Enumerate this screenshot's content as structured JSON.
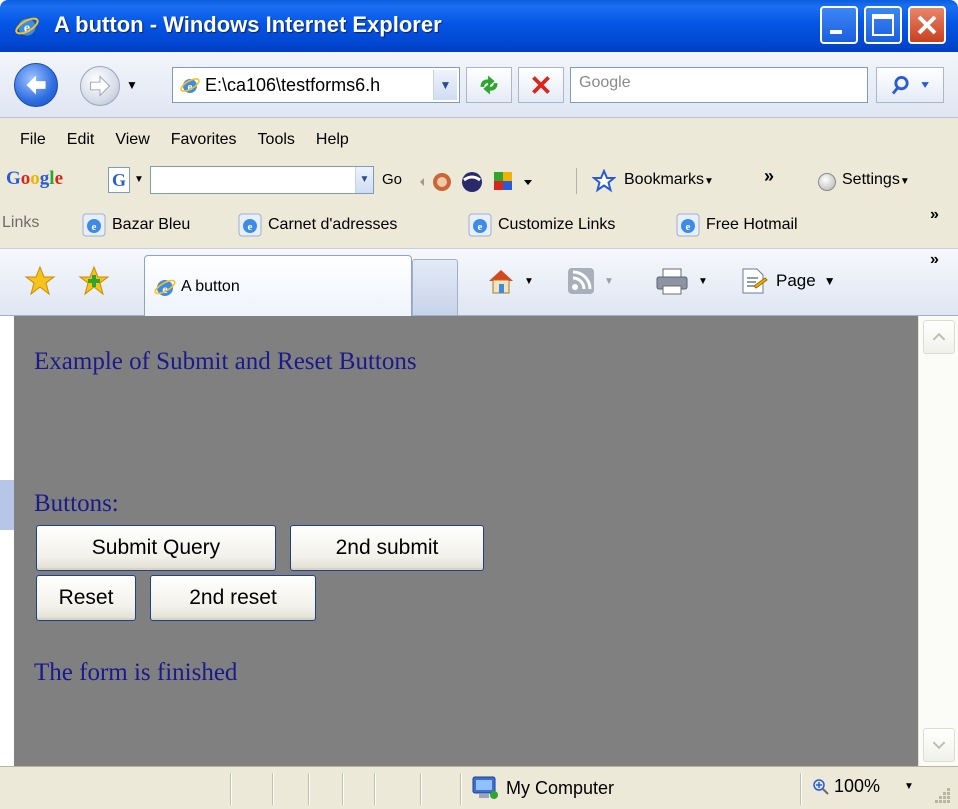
{
  "window": {
    "title": "A button - Windows Internet Explorer"
  },
  "navbar": {
    "address": "E:\\ca106\\testforms6.h",
    "search_placeholder": "Google"
  },
  "menu": {
    "items": [
      "File",
      "Edit",
      "View",
      "Favorites",
      "Tools",
      "Help"
    ]
  },
  "google_toolbar": {
    "logo": "Google",
    "go_label": "Go",
    "bookmarks_label": "Bookmarks",
    "more_label": "»",
    "settings_label": "Settings"
  },
  "links_bar": {
    "label": "Links",
    "links": [
      "Bazar Bleu",
      "Carnet d'adresses",
      "Customize Links",
      "Free Hotmail"
    ],
    "more_label": "»"
  },
  "tabs": {
    "active_label": "A button",
    "page_label": "Page",
    "more_label": "»"
  },
  "content": {
    "heading": "Example of Submit and Reset Buttons",
    "buttons_label": "Buttons:",
    "buttons": {
      "submit": "Submit Query",
      "submit2": "2nd submit",
      "reset": "Reset",
      "reset2": "2nd reset"
    },
    "footer_text": "The form is finished"
  },
  "statusbar": {
    "zone": "My Computer",
    "zoom": "100%"
  },
  "icons": {
    "app": "ie-icon",
    "back": "back-arrow-icon",
    "forward": "forward-arrow-icon",
    "refresh": "refresh-icon",
    "stop": "stop-icon",
    "search": "search-icon",
    "home": "home-icon",
    "feeds": "rss-icon",
    "print": "print-icon",
    "page": "page-icon",
    "favorites": "favorites-star-icon",
    "add_favorites": "add-favorites-icon",
    "zone": "computer-icon",
    "zoom": "zoom-icon"
  },
  "colors": {
    "titlebar": "#0556e6",
    "content_bg": "#808080",
    "content_text": "#1a1a8c",
    "chrome": "#ece9d8"
  }
}
